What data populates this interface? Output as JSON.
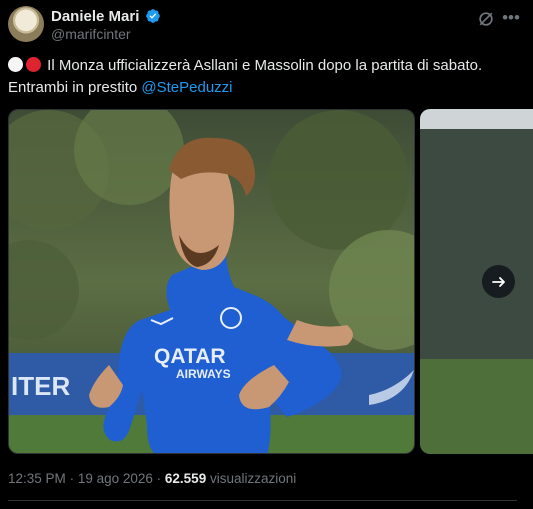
{
  "author": {
    "name": "Daniele Mari",
    "handle": "@marifcinter"
  },
  "tweet": {
    "text_part1": "Il Monza ufficializzerà Asllani e Massolin dopo la partita di sabato.",
    "text_part2": "Entrambi in prestito",
    "mention": "@StePeduzzi"
  },
  "media": {
    "jersey_sponsor_line1": "QATAR",
    "jersey_sponsor_line2": "AIRWAYS",
    "banner_text": "ITER"
  },
  "meta": {
    "time": "12:35 PM",
    "date": "19 ago 2026",
    "views_count": "62.559",
    "views_label": "visualizzazioni"
  },
  "icons": {
    "verified": "verified-badge-icon",
    "grok": "grok-icon",
    "more": "more-icon",
    "next": "arrow-right-icon"
  },
  "colors": {
    "background": "#000000",
    "text": "#e7e9ea",
    "secondary": "#71767b",
    "accent": "#1d9bf0",
    "jersey": "#1f5fd1"
  }
}
